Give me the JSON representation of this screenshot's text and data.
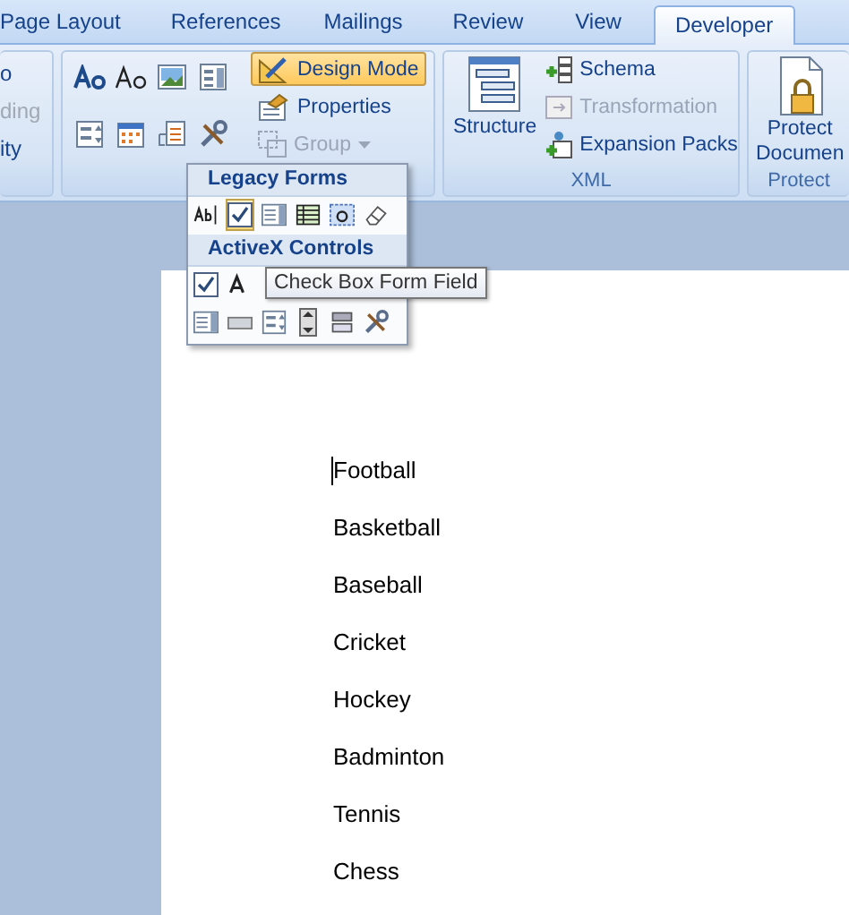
{
  "tabs": [
    {
      "label": "Page Layout",
      "selected": false
    },
    {
      "label": "References",
      "selected": false
    },
    {
      "label": "Mailings",
      "selected": false
    },
    {
      "label": "Review",
      "selected": false
    },
    {
      "label": "View",
      "selected": false
    },
    {
      "label": "Developer",
      "selected": true
    }
  ],
  "ribbon": {
    "partial_group": {
      "items": [
        {
          "label": "o",
          "disabled": false
        },
        {
          "label": "ding",
          "disabled": true
        },
        {
          "label": "ity",
          "disabled": false
        }
      ]
    },
    "controls_group": {
      "buttons": [
        {
          "label": "Design Mode",
          "active": true,
          "disabled": false
        },
        {
          "label": "Properties",
          "active": false,
          "disabled": false
        },
        {
          "label": "Group",
          "active": false,
          "disabled": true
        }
      ]
    },
    "xml_group": {
      "label": "XML",
      "large_button": "Structure",
      "buttons": [
        {
          "label": "Schema",
          "disabled": false
        },
        {
          "label": "Transformation",
          "disabled": true
        },
        {
          "label": "Expansion Packs",
          "disabled": false
        }
      ]
    },
    "protect_group": {
      "label": "Protect",
      "button_lines": [
        "Protect",
        "Documen"
      ]
    }
  },
  "dropdown": {
    "sections": [
      {
        "title": "Legacy Forms",
        "items": [
          {
            "hovered": false
          },
          {
            "hovered": true
          },
          {
            "hovered": false
          },
          {
            "hovered": false
          },
          {
            "hovered": false
          },
          {
            "hovered": false
          }
        ]
      },
      {
        "title": "ActiveX Controls",
        "items": [
          {
            "hovered": false
          },
          {
            "hovered": false
          },
          {
            "hovered": false
          },
          {
            "hovered": false
          },
          {
            "hovered": false
          },
          {
            "hovered": false
          },
          {
            "hovered": false
          },
          {
            "hovered": false
          }
        ]
      }
    ]
  },
  "tooltip": "Check Box Form Field",
  "document": {
    "lines": [
      "Football",
      "Basketball",
      "Baseball",
      "Cricket",
      "Hockey",
      "Badminton",
      "Tennis",
      "Chess"
    ]
  }
}
